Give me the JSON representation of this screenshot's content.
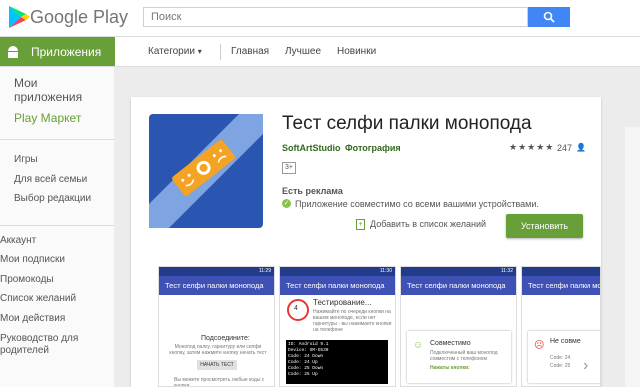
{
  "header": {
    "logo_text": "Google Play",
    "search_placeholder": "Поиск"
  },
  "nav": {
    "apps_tab": "Приложения",
    "categories": "Категории",
    "home": "Главная",
    "top": "Лучшее",
    "new": "Новинки"
  },
  "sidebar": {
    "my_apps": "Мои приложения",
    "play_store": "Play Маркет",
    "games": "Игры",
    "family": "Для всей семьи",
    "editors": "Выбор редакции",
    "account": "Аккаунт",
    "subscriptions": "Мои подписки",
    "promo": "Промокоды",
    "wishlist": "Список желаний",
    "activity": "Мои действия",
    "parent_guide": "Руководство для родителей"
  },
  "app": {
    "title": "Тест селфи палки моноподa",
    "developer": "SoftArtStudio",
    "category": "Фотография",
    "stars": "★★★★★",
    "rating_value": 3.5,
    "review_count": "247",
    "age_rating": "3+",
    "ads_label": "Есть реклама",
    "compat_text": "Приложение совместимо со всеми вашими устройствами.",
    "wishlist_label": "Добавить в список желаний",
    "install_label": "Установить"
  },
  "screenshots": {
    "time1": "11:29",
    "time2": "11:30",
    "time3": "11:32",
    "app_bar_title": "Тест селфи палки моноподa",
    "s1_heading": "Подсоедините:",
    "s1_body": "Монопод палку, гарнитуру или селфи кнопку, затем нажмите кнопку начать тест",
    "s1_button": "НАЧАТЬ ТЕСТ",
    "s1_footer": "Вы можете просмотреть любые коды с кнопки",
    "s2_heading": "Тестирование...",
    "s2_count": "4",
    "s2_body": "Нажимайте по очереди кнопки на вашем моноподе, если нет гарнитуры - вы нажимаете кнопки на телефоне",
    "s2_console": "ID: Android 9.1\nDevice: SM-G530\nCode: 24 Down\nCode: 24 Up\nCode: 25 Down\nCode: 25 Up",
    "s3_heading": "Совместимо",
    "s3_body": "Подключенный ваш монопод совместим с телефоном",
    "s3_codes": "Нажаты кнопки:",
    "s4_heading": "Не совме",
    "s4_code": "Code: 24",
    "s4_code2": "Code: 25"
  },
  "colors": {
    "brand_green": "#689f38",
    "indigo": "#3f51b5",
    "search_blue": "#4285f4"
  }
}
